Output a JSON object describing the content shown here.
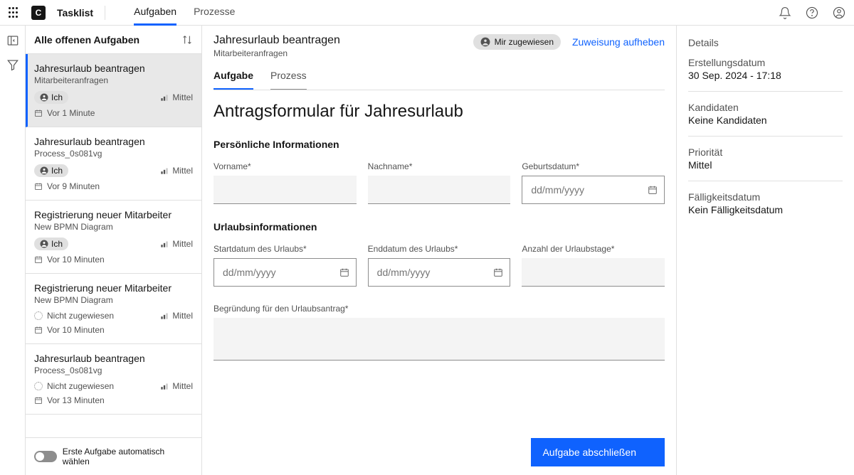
{
  "header": {
    "appTitle": "Tasklist",
    "tabs": [
      "Aufgaben",
      "Prozesse"
    ],
    "activeTab": 0
  },
  "taskList": {
    "title": "Alle offenen Aufgaben",
    "footerToggleLabel": "Erste Aufgabe automatisch wählen",
    "tasks": [
      {
        "title": "Jahresurlaub beantragen",
        "subtitle": "Mitarbeiteranfragen",
        "assignee": "Ich",
        "assigned": true,
        "priority": "Mittel",
        "time": "Vor 1 Minute",
        "selected": true
      },
      {
        "title": "Jahresurlaub beantragen",
        "subtitle": "Process_0s081vg",
        "assignee": "Ich",
        "assigned": true,
        "priority": "Mittel",
        "time": "Vor 9 Minuten",
        "selected": false
      },
      {
        "title": "Registrierung neuer Mitarbeiter",
        "subtitle": "New BPMN Diagram",
        "assignee": "Ich",
        "assigned": true,
        "priority": "Mittel",
        "time": "Vor 10 Minuten",
        "selected": false
      },
      {
        "title": "Registrierung neuer Mitarbeiter",
        "subtitle": "New BPMN Diagram",
        "assignee": "Nicht zugewiesen",
        "assigned": false,
        "priority": "Mittel",
        "time": "Vor 10 Minuten",
        "selected": false
      },
      {
        "title": "Jahresurlaub beantragen",
        "subtitle": "Process_0s081vg",
        "assignee": "Nicht zugewiesen",
        "assigned": false,
        "priority": "Mittel",
        "time": "Vor 13 Minuten",
        "selected": false
      }
    ]
  },
  "taskDetail": {
    "title": "Jahresurlaub beantragen",
    "subtitle": "Mitarbeiteranfragen",
    "assignedBadge": "Mir zugewiesen",
    "unassignLink": "Zuweisung aufheben",
    "tabs": [
      "Aufgabe",
      "Prozess"
    ],
    "activeTab": 0,
    "formTitle": "Antragsformular für Jahresurlaub",
    "section1": "Persönliche Informationen",
    "section2": "Urlaubsinformationen",
    "labels": {
      "firstname": "Vorname*",
      "lastname": "Nachname*",
      "birthdate": "Geburtsdatum*",
      "startdate": "Startdatum des Urlaubs*",
      "enddate": "Enddatum des Urlaubs*",
      "days": "Anzahl der Urlaubstage*",
      "reason": "Begründung für den Urlaubsantrag*"
    },
    "datePlaceholder": "dd/mm/yyyy",
    "submitButton": "Aufgabe abschließen"
  },
  "details": {
    "heading": "Details",
    "creationLabel": "Erstellungsdatum",
    "creationValue": "30 Sep. 2024 - 17:18",
    "candidatesLabel": "Kandidaten",
    "candidatesValue": "Keine Kandidaten",
    "priorityLabel": "Priorität",
    "priorityValue": "Mittel",
    "dueLabel": "Fälligkeitsdatum",
    "dueValue": "Kein Fälligkeitsdatum"
  }
}
